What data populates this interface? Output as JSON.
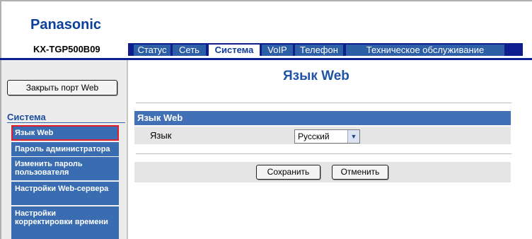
{
  "header": {
    "brand": "Panasonic",
    "model": "KX-TGP500B09"
  },
  "tabs": [
    {
      "label": "Статус",
      "active": false
    },
    {
      "label": "Сеть",
      "active": false
    },
    {
      "label": "Система",
      "active": true
    },
    {
      "label": "VoIP",
      "active": false
    },
    {
      "label": "Телефон",
      "active": false
    },
    {
      "label": "Техническое обслуживание",
      "active": false
    }
  ],
  "sidebar": {
    "close_port_label": "Закрыть порт Web",
    "section_title": "Система",
    "items": [
      {
        "label": "Язык Web",
        "selected": true
      },
      {
        "label": "Пароль администратора",
        "selected": false
      },
      {
        "label": "Изменить пароль пользователя",
        "selected": false
      },
      {
        "label": "Настройки Web-сервера",
        "selected": false
      },
      {
        "label": "Настройки корректировки времени",
        "selected": false
      }
    ]
  },
  "main": {
    "page_title": "Язык Web",
    "section_header": "Язык Web",
    "language_label": "Язык",
    "language_value": "Русский",
    "save_label": "Сохранить",
    "cancel_label": "Отменить"
  },
  "colors": {
    "brand": "#0a3f9c",
    "nav_bar": "#0f1e8f",
    "tab": "#2c5fa6",
    "section_header": "#4170b6",
    "selected_border": "#e01b2b"
  }
}
